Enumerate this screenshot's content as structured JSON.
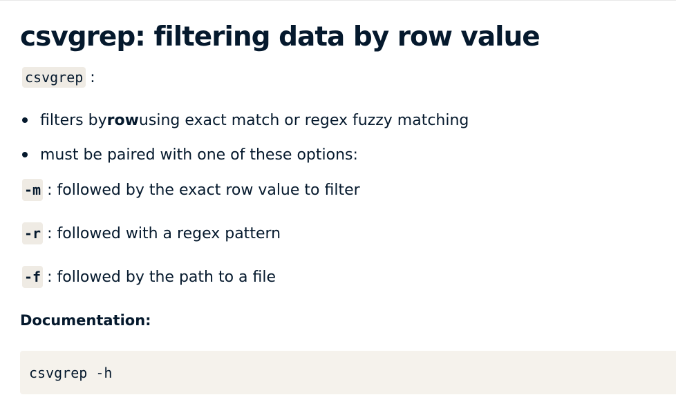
{
  "slide": {
    "title": "csvgrep: filtering data by row value",
    "intro": {
      "code": "csvgrep",
      "suffix": ":"
    },
    "bullets": [
      {
        "before": "filters by ",
        "bold": "row",
        "after": " using exact match or regex fuzzy matching"
      },
      {
        "text": "must be paired with one of these options:"
      }
    ],
    "options": [
      {
        "flag": "-m",
        "description": ": followed by the exact row value to filter"
      },
      {
        "flag": "-r",
        "description": ": followed with a regex pattern"
      },
      {
        "flag": "-f",
        "description": ": followed by the path to a file"
      }
    ],
    "documentation_label": "Documentation:",
    "code_block": "csvgrep -h"
  },
  "colors": {
    "text": "#05192d",
    "inline_code_bg": "#efebe4",
    "code_block_bg": "#f5f2ec"
  }
}
